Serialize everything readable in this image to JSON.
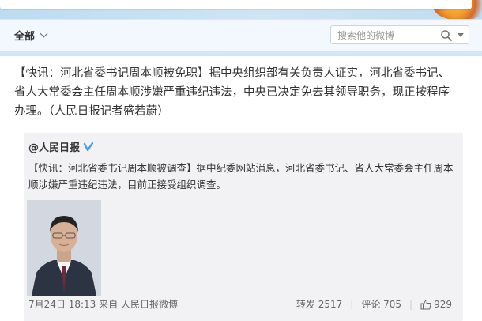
{
  "filter": {
    "all_label": "全部",
    "search_placeholder": "搜索他的微博"
  },
  "post": {
    "text": "【快讯：河北省委书记周本顺被免职】据中央组织部有关负责人证实，河北省委书记、省人大常委会主任周本顺涉嫌严重违纪违法，中央已决定免去其领导职务，现正按程序办理。（人民日报记者盛若蔚）"
  },
  "repost": {
    "user": "@人民日报",
    "text": "【快讯：河北省委书记周本顺被调查】据中纪委网站消息，河北省委书记、省人大常委会主任周本顺涉嫌严重违纪违法，目前正接受组织调查。",
    "time": "7月24日 18:13",
    "source_prefix": "来自",
    "source": "人民日报微博",
    "repost_label": "转发 2517",
    "comment_label": "评论 705",
    "like_count": "929"
  },
  "colors": {
    "verified": "#4a9be8",
    "page_bg": "#d7ebf7"
  }
}
